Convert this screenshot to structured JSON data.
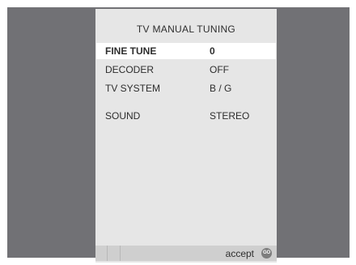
{
  "menu": {
    "title": "TV  MANUAL  TUNING",
    "items": [
      {
        "label": "FINE  TUNE",
        "value": "0",
        "selected": true
      },
      {
        "label": "DECODER",
        "value": "OFF",
        "selected": false
      },
      {
        "label": "TV SYSTEM",
        "value": "B / G",
        "selected": false
      },
      {
        "label": "SOUND",
        "value": "STEREO",
        "selected": false
      }
    ]
  },
  "footer": {
    "accept_label": "accept",
    "go_icon": "GO"
  },
  "colors": {
    "background_frame": "#717175",
    "panel": "#e6e6e6",
    "highlight": "#ffffff",
    "text": "#2e2e2e"
  }
}
